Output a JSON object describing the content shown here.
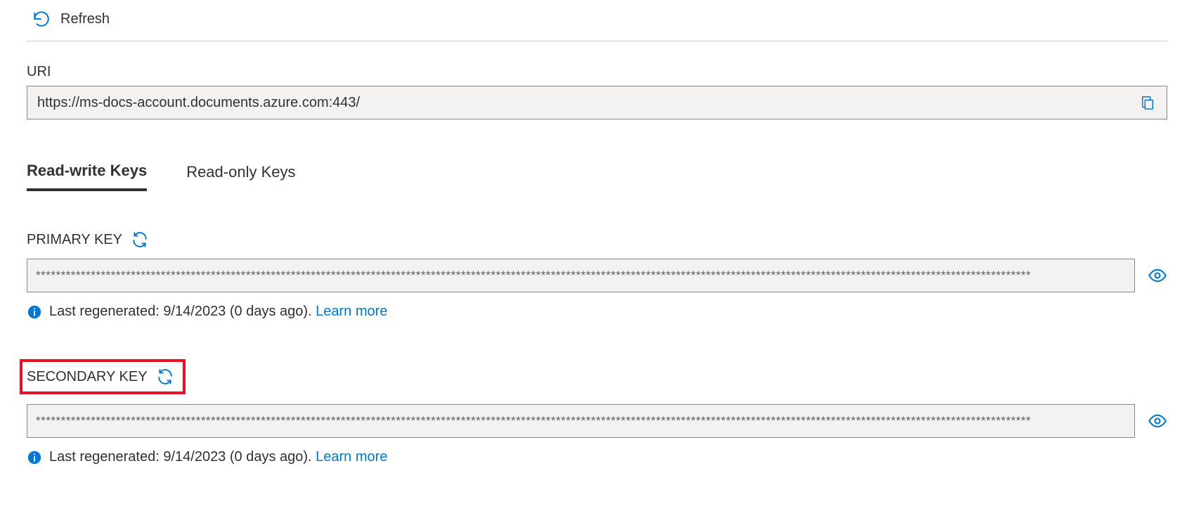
{
  "toolbar": {
    "refresh_label": "Refresh"
  },
  "uri": {
    "label": "URI",
    "value": "https://ms-docs-account.documents.azure.com:443/"
  },
  "tabs": {
    "read_write": "Read-write Keys",
    "read_only": "Read-only Keys"
  },
  "primary": {
    "label": "PRIMARY KEY",
    "masked": "*******************************************************************************************************************************************************************************************************",
    "info": "Last regenerated: 9/14/2023 (0 days ago). ",
    "learn": "Learn more"
  },
  "secondary": {
    "label": "SECONDARY KEY",
    "masked": "*******************************************************************************************************************************************************************************************************",
    "info": "Last regenerated: 9/14/2023 (0 days ago). ",
    "learn": "Learn more"
  }
}
